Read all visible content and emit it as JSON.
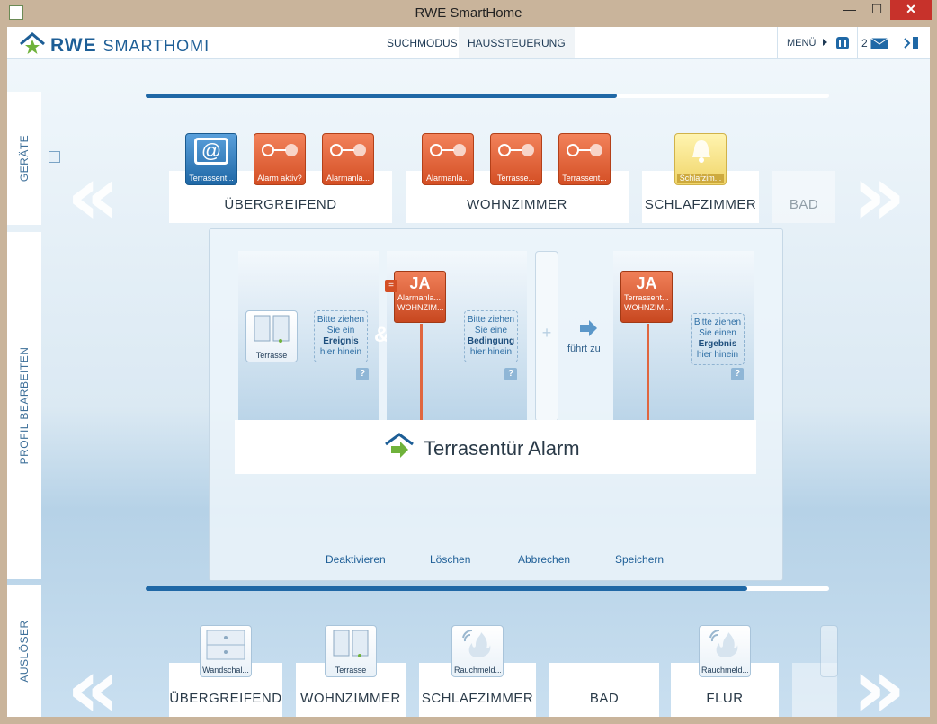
{
  "window": {
    "title": "RWE SmartHome",
    "min": "—",
    "max": "☐",
    "close": "✕"
  },
  "header": {
    "brand_bold": "RWE",
    "brand_light": "SMARTHOMI",
    "tabs": [
      "SUCHMODUS",
      "HAUSSTEUERUNG"
    ],
    "menu_label": "MENÜ",
    "message_count": "2"
  },
  "side_tabs": [
    "GERÄTE",
    "PROFIL BEARBEITEN",
    "AUSLÖSER"
  ],
  "top_progress": 0.69,
  "bottom_progress": 0.88,
  "top_rooms": [
    {
      "name": "ÜBERGREIFEND",
      "tiles": [
        {
          "label": "Terrassent...",
          "color": "blue",
          "icon": "at-icon"
        },
        {
          "label": "Alarm aktiv?",
          "color": "orange",
          "icon": "toggle-icon"
        },
        {
          "label": "Alarmanla...",
          "color": "orange",
          "icon": "toggle-icon"
        }
      ]
    },
    {
      "name": "WOHNZIMMER",
      "tiles": [
        {
          "label": "Alarmanla...",
          "color": "orange",
          "icon": "toggle-icon"
        },
        {
          "label": "Terrasse...",
          "color": "orange",
          "icon": "toggle-icon"
        },
        {
          "label": "Terrassent...",
          "color": "orange",
          "icon": "toggle-icon"
        }
      ]
    },
    {
      "name": "SCHLAFZIMMER",
      "tiles": [
        {
          "label": "Schlafzim...",
          "color": "yellow",
          "icon": "bell-icon"
        }
      ]
    },
    {
      "name": "BAD",
      "tiles": []
    }
  ],
  "rule": {
    "trigger_device": "Terrasse",
    "event_hint": [
      "Bitte ziehen",
      "Sie ein",
      "Ereignis",
      "hier hinein"
    ],
    "and_symbol": "&",
    "condition": {
      "badge": "JA",
      "line1": "Alarmanla...",
      "line2": "WOHNZIM...",
      "eq": "="
    },
    "condition_hint": [
      "Bitte ziehen",
      "Sie eine",
      "Bedingung",
      "hier hinein"
    ],
    "plus": "+",
    "leads_to": "führt zu",
    "result": {
      "badge": "JA",
      "line1": "Terrassent...",
      "line2": "WOHNZIM..."
    },
    "result_hint": [
      "Bitte ziehen",
      "Sie einen",
      "Ergebnis",
      "hier hinein"
    ],
    "help": "?",
    "profile_name": "Terrasentür Alarm",
    "actions": [
      "Deaktivieren",
      "Löschen",
      "Abbrechen",
      "Speichern"
    ]
  },
  "bottom_rooms": [
    {
      "name": "ÜBERGREIFEND",
      "tile": {
        "label": "Wandschal...",
        "icon": "wall-switch-icon"
      }
    },
    {
      "name": "WOHNZIMMER",
      "tile": {
        "label": "Terrasse",
        "icon": "door-icon"
      }
    },
    {
      "name": "SCHLAFZIMMER",
      "tile": {
        "label": "Rauchmeld...",
        "icon": "smoke-detector-icon"
      }
    },
    {
      "name": "BAD",
      "tile": null
    },
    {
      "name": "FLUR",
      "tile": {
        "label": "Rauchmeld...",
        "icon": "smoke-detector-icon"
      }
    }
  ]
}
